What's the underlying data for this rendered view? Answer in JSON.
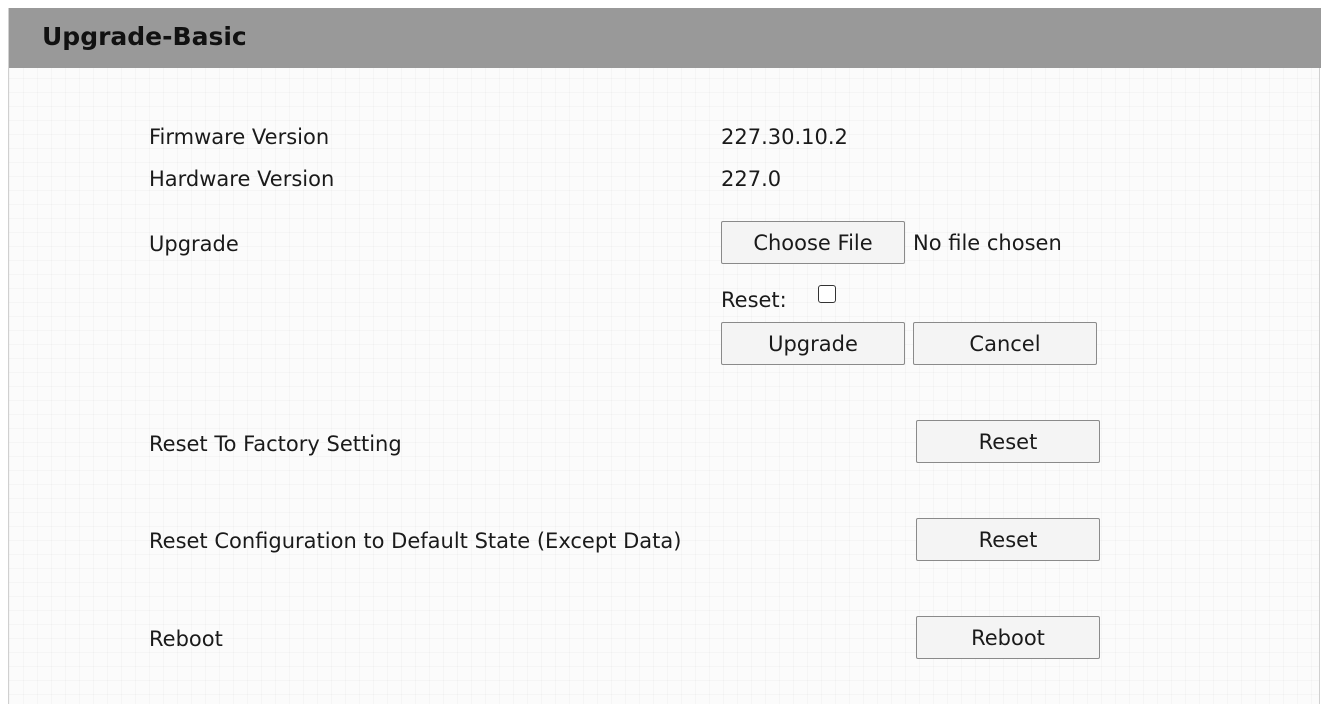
{
  "header": {
    "title": "Upgrade-Basic"
  },
  "info": {
    "firmware_label": "Firmware Version",
    "firmware_value": "227.30.10.2",
    "hardware_label": "Hardware Version",
    "hardware_value": "227.0"
  },
  "upgrade": {
    "label": "Upgrade",
    "choose_file_label": "Choose File",
    "file_status": "No file chosen",
    "reset_label": "Reset:",
    "reset_checked": false,
    "upgrade_button": "Upgrade",
    "cancel_button": "Cancel"
  },
  "factory_reset": {
    "label": "Reset To Factory Setting",
    "button": "Reset"
  },
  "config_reset": {
    "label": "Reset Configuration to Default State (Except Data)",
    "button": "Reset"
  },
  "reboot": {
    "label": "Reboot",
    "button": "Reboot"
  },
  "colors": {
    "titlebar": "#999999",
    "background": "#fbfbfb"
  }
}
